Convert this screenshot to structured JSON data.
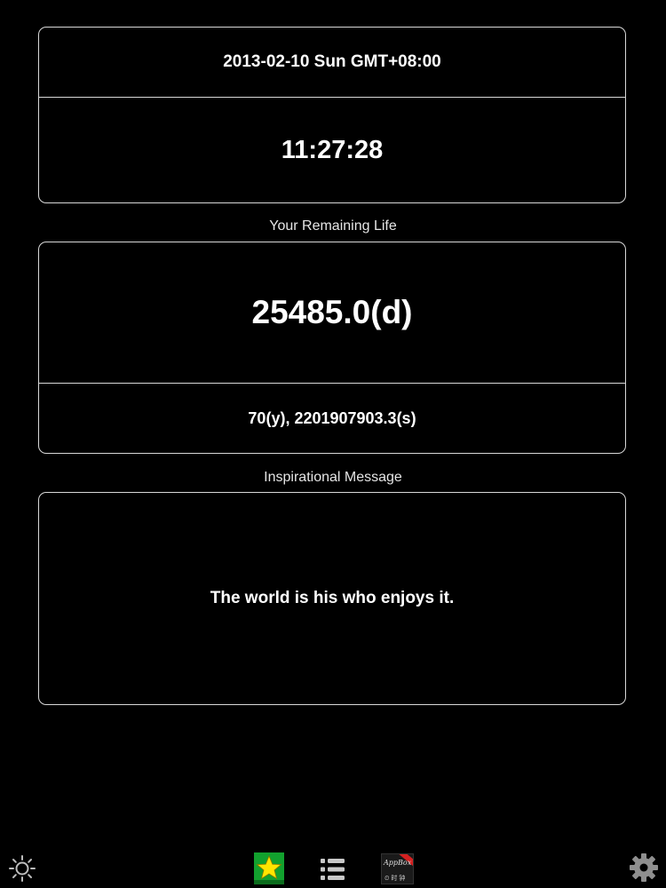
{
  "clock": {
    "date": "2013-02-10 Sun GMT+08:00",
    "time": "11:27:28"
  },
  "remaining": {
    "heading": "Your Remaining Life",
    "days": "25485.0(d)",
    "details": "70(y), 2201907903.3(s)"
  },
  "inspiration": {
    "heading": "Inspirational Message",
    "message": "The world is his who enjoys it."
  },
  "toolbar": {
    "items": [
      {
        "icon": "brightness-icon"
      },
      {
        "icon": "favorite-star-icon"
      },
      {
        "icon": "list-icon"
      },
      {
        "icon": "app-promo-icon",
        "badge_text": "AppBox",
        "sub_text": "⏲ 时 钟"
      },
      {
        "icon": "gear-icon"
      }
    ]
  },
  "colors": {
    "background": "#000000",
    "border": "#d8d8d8",
    "text": "#ffffff",
    "star_bg": "#12a12e",
    "star": "#ffe600"
  }
}
